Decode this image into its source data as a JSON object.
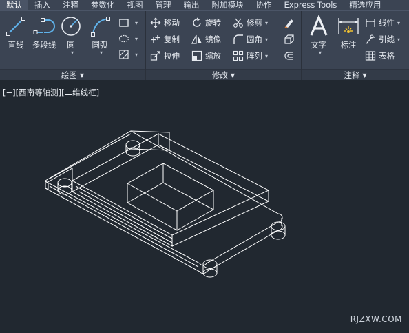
{
  "tabs": [
    "默认",
    "插入",
    "注释",
    "参数化",
    "视图",
    "管理",
    "输出",
    "附加模块",
    "协作",
    "Express Tools",
    "精选应用"
  ],
  "ribbon": {
    "draw": {
      "title": "绘图",
      "line": "直线",
      "polyline": "多段线",
      "circle": "圆",
      "arc": "圆弧"
    },
    "modify": {
      "title": "修改",
      "move": "移动",
      "rotate": "旋转",
      "trim": "修剪",
      "copy": "复制",
      "mirror": "镜像",
      "fillet": "圆角",
      "stretch": "拉伸",
      "scale": "缩放",
      "array": "阵列"
    },
    "annotation": {
      "title": "注释",
      "text": "文字",
      "dimension": "标注",
      "linear": "线性",
      "leader": "引线",
      "table": "表格"
    }
  },
  "viewport": {
    "label": "[−][西南等轴测][二维线框]"
  },
  "watermark": "RJZXW.COM",
  "colors": {
    "canvas": "#212830",
    "ribbon": "#3b4453",
    "accent_blue": "#5fb2ea",
    "model_lines": "#ffffff"
  }
}
